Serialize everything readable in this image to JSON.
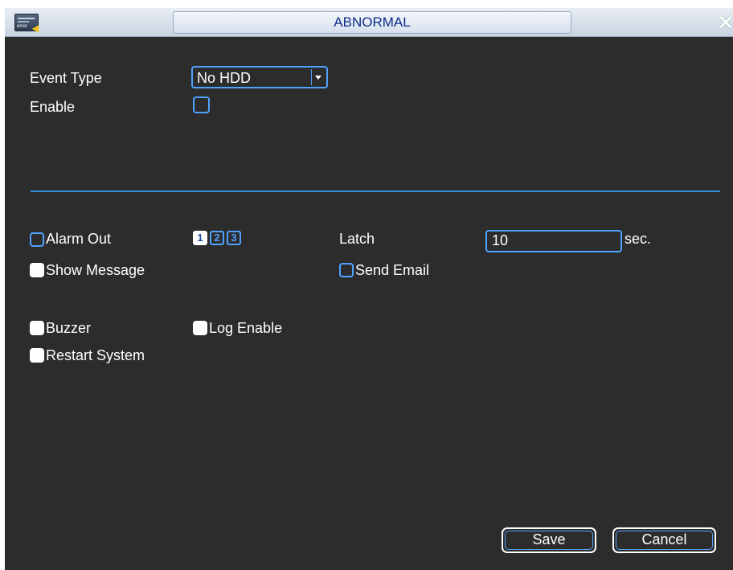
{
  "window": {
    "title": "ABNORMAL",
    "close_glyph": "✕",
    "app_icon_tag": "error"
  },
  "form": {
    "event_type_label": "Event Type",
    "event_type_value": "No HDD",
    "enable_label": "Enable",
    "enable_checked": false,
    "alarm_out_label": "Alarm Out",
    "alarm_out_checked": false,
    "alarm_channels": [
      {
        "label": "1",
        "selected": true
      },
      {
        "label": "2",
        "selected": false
      },
      {
        "label": "3",
        "selected": false
      }
    ],
    "latch_label": "Latch",
    "latch_value": "10",
    "latch_unit": "sec.",
    "show_message_label": "Show Message",
    "show_message_checked": true,
    "send_email_label": "Send Email",
    "send_email_checked": false,
    "buzzer_label": "Buzzer",
    "buzzer_checked": true,
    "log_enable_label": "Log Enable",
    "log_enable_checked": true,
    "restart_system_label": "Restart System",
    "restart_system_checked": true
  },
  "buttons": {
    "save": "Save",
    "cancel": "Cancel"
  },
  "colors": {
    "background": "#2c2c2c",
    "accent": "#4fa3ff",
    "title_text": "#0b2a8c",
    "text": "#ffffff"
  }
}
